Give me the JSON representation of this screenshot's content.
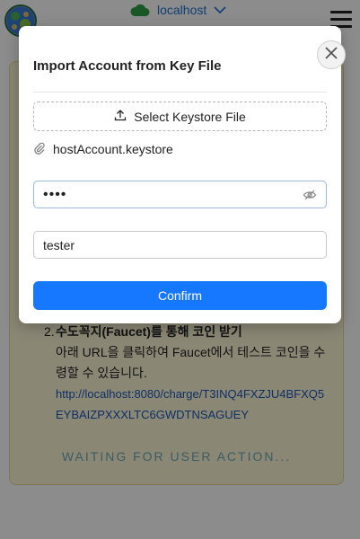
{
  "header": {
    "network_label": "localhost",
    "icons": [
      "app-logo",
      "cloud-icon",
      "chevron-down-icon",
      "hamburger-menu-icon"
    ]
  },
  "instructions": {
    "step2_number": "2.",
    "step2_title": "수도꼭지(Faucet)를 통해 코인 받기",
    "step2_body": "아래 URL을 클릭하여 Faucet에서 테스트 코인을 수령할 수 있습니다.",
    "faucet_url": "http://localhost:8080/charge/T3INQ4FXZJU4BFXQ5EYBAIZPXXXLTC6GWDTNSAGUEY",
    "status": "WAITING FOR USER ACTION..."
  },
  "modal": {
    "title": "Import Account from Key File",
    "upload_label": "Select Keystore File",
    "file_name": "hostAccount.keystore",
    "password_value": "pass",
    "name_value": "tester",
    "confirm_label": "Confirm"
  },
  "colors": {
    "accent": "#1677ff",
    "panel_bg": "#fdf6d6",
    "link": "#1a56b8",
    "network_cloud": "#2e9e46"
  }
}
